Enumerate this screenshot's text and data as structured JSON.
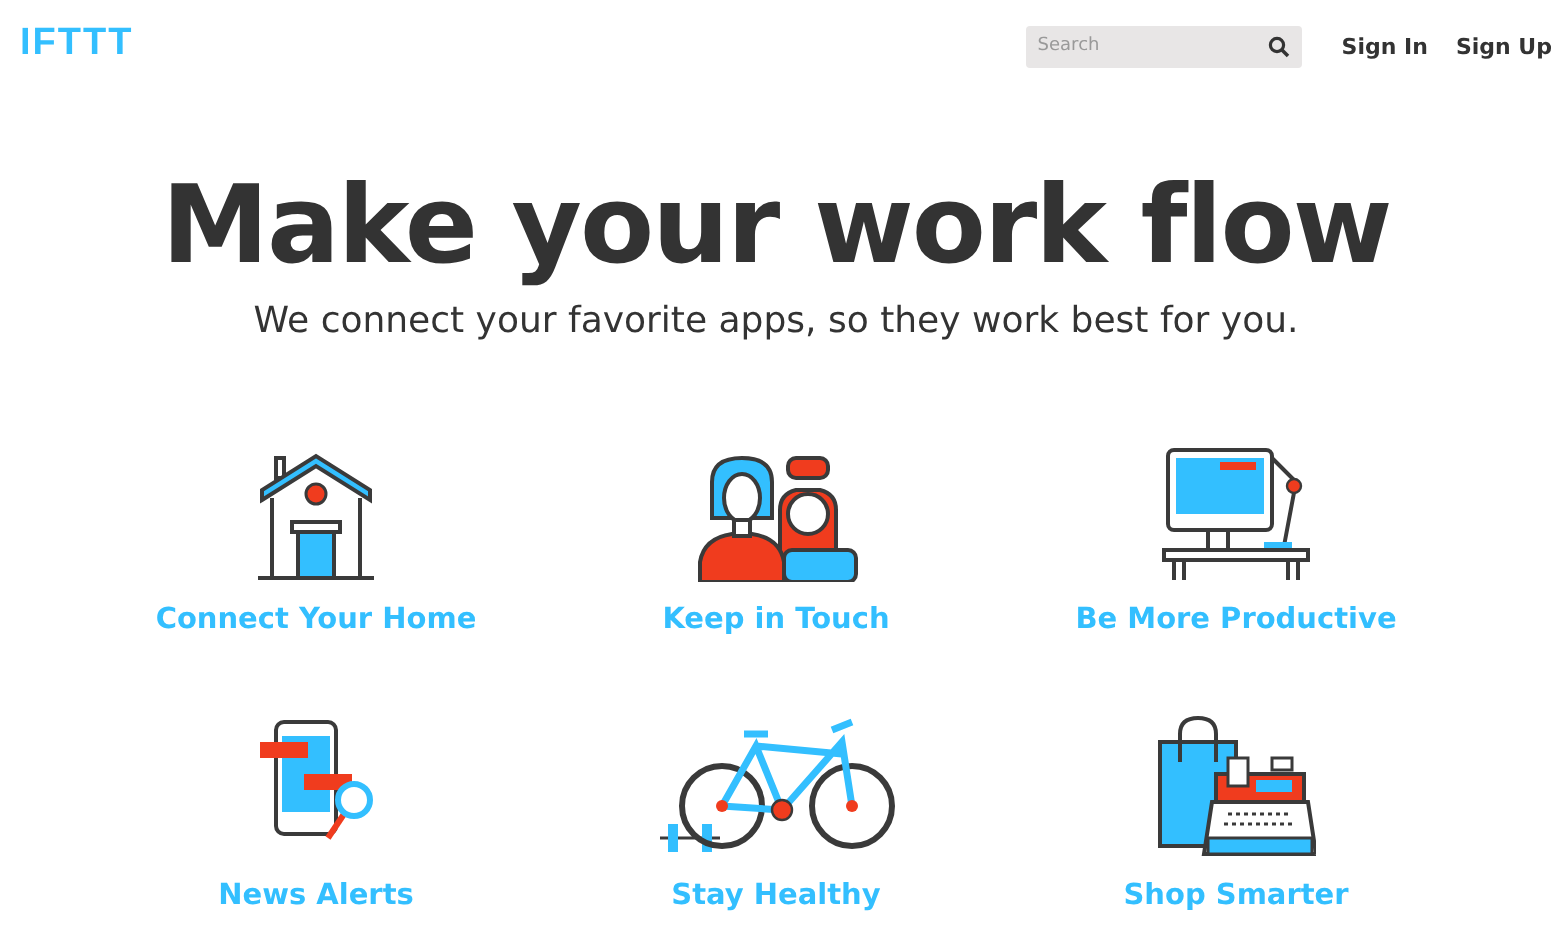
{
  "header": {
    "logo": "IFTTT",
    "search": {
      "placeholder": "Search"
    },
    "links": [
      "Sign In",
      "Sign Up"
    ]
  },
  "hero": {
    "title": "Make your work flow",
    "subtitle": "We connect your favorite apps, so they work best for you."
  },
  "categories": [
    {
      "label": "Connect Your Home",
      "kind": "house"
    },
    {
      "label": "Keep in Touch",
      "kind": "people"
    },
    {
      "label": "Be More Productive",
      "kind": "desk"
    },
    {
      "label": "News Alerts",
      "kind": "phone"
    },
    {
      "label": "Stay Healthy",
      "kind": "bike"
    },
    {
      "label": "Shop Smarter",
      "kind": "shop"
    }
  ]
}
